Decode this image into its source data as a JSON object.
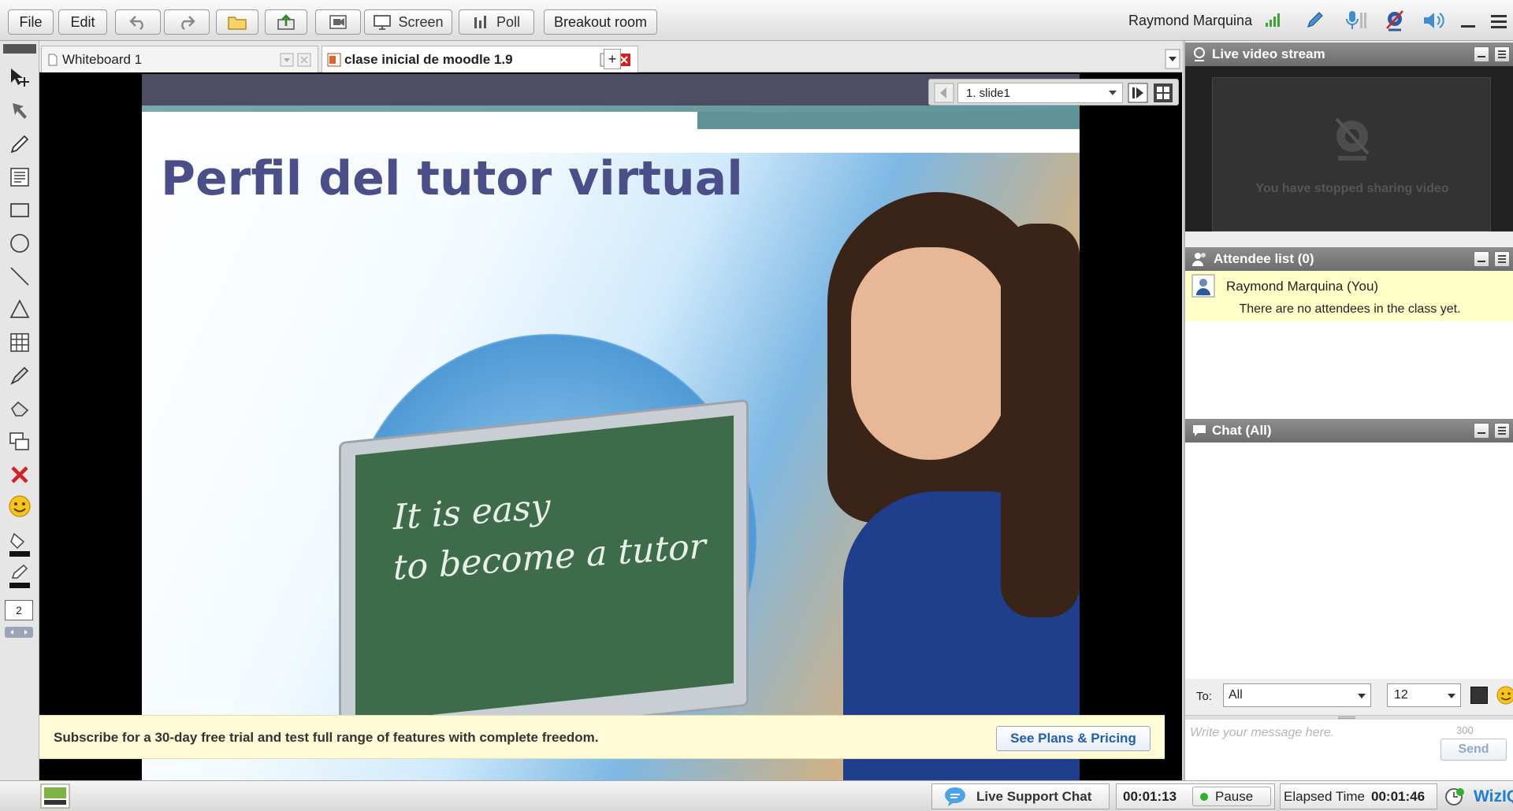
{
  "menu": {
    "file": "File",
    "edit": "Edit",
    "screen": "Screen",
    "poll": "Poll",
    "breakout": "Breakout room"
  },
  "user": {
    "name": "Raymond Marquina"
  },
  "tabs": [
    {
      "label": "Whiteboard 1"
    },
    {
      "label": "clase inicial de moodle 1.9"
    }
  ],
  "add_tab": "+",
  "slide_nav": {
    "selected": "1. slide1"
  },
  "slide": {
    "title": "Perfil del tutor virtual",
    "board_line1": "It is easy",
    "board_line2": "to become a tutor"
  },
  "promo": {
    "text": "Subscribe for a 30-day free trial and test full range of features with complete freedom.",
    "button": "See Plans & Pricing"
  },
  "tool_stroke": "2",
  "video": {
    "header": "Live video stream",
    "stopped_text": "You have stopped sharing video"
  },
  "attendees": {
    "header": "Attendee list (0)",
    "self": "Raymond Marquina (You)",
    "empty": "There are no attendees in the class yet."
  },
  "chat": {
    "header": "Chat (All)",
    "to_label": "To:",
    "to_value": "All",
    "font_size": "12",
    "placeholder": "Write your message here.",
    "char_count": "300",
    "send": "Send"
  },
  "bottom": {
    "live_support": "Live Support Chat",
    "timer": "00:01:13",
    "pause": "Pause",
    "elapsed_label": "Elapsed Time",
    "elapsed_value": "00:01:46",
    "brand": "WizIQ"
  },
  "colors": {
    "accent_blue": "#1f5fb5",
    "slide_title": "#4a4f8a",
    "board_green": "#3e6b4a",
    "notice_yellow": "#fffbd6",
    "close_red": "#d42020"
  }
}
